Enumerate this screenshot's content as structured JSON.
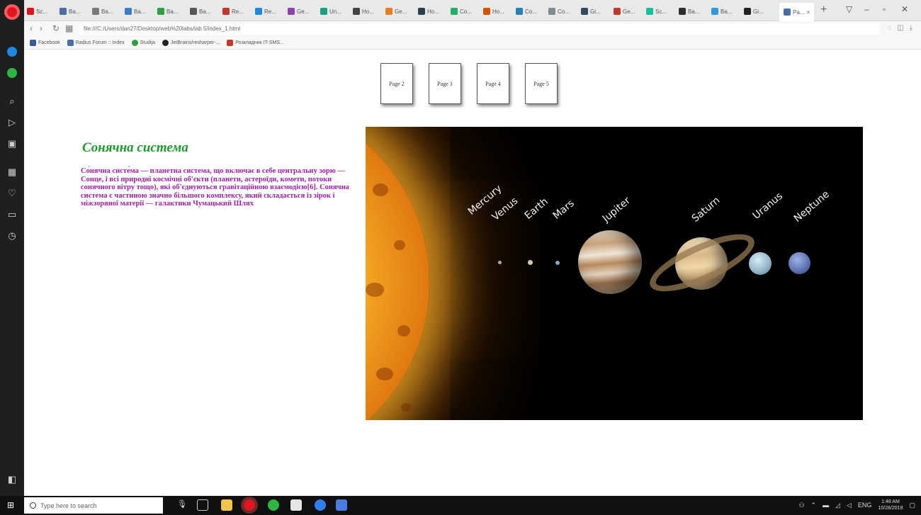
{
  "browser": {
    "tabs": [
      {
        "label": "Sc..."
      },
      {
        "label": "Ba..."
      },
      {
        "label": "Ba..."
      },
      {
        "label": "Ba..."
      },
      {
        "label": "Ba..."
      },
      {
        "label": "Ba..."
      },
      {
        "label": "Re..."
      },
      {
        "label": "Re..."
      },
      {
        "label": "Ge..."
      },
      {
        "label": "Un..."
      },
      {
        "label": "Ho..."
      },
      {
        "label": "Ge..."
      },
      {
        "label": "Ho..."
      },
      {
        "label": "Co..."
      },
      {
        "label": "Ho..."
      },
      {
        "label": "Co..."
      },
      {
        "label": "Co..."
      },
      {
        "label": "Gi..."
      },
      {
        "label": "Ge..."
      },
      {
        "label": "Sc..."
      },
      {
        "label": "Ba..."
      },
      {
        "label": "Ba..."
      },
      {
        "label": "Gi..."
      }
    ],
    "active_tab": {
      "label": "Pa..."
    },
    "address": "file:///C:/Users/dan27/Desktop/web%20labs/lab 5/index_1.html",
    "bookmarks": [
      {
        "label": "Facebook"
      },
      {
        "label": "Radius Forum :: Index"
      },
      {
        "label": "Studija"
      },
      {
        "label": "JetBrains/resharper-..."
      },
      {
        "label": "Розкладник IT-SMS..."
      }
    ]
  },
  "page": {
    "nav_pages": [
      "Page 2",
      "Page 3",
      "Page 4",
      "Page 5"
    ],
    "title": "Сонячна система",
    "text": "Со́нячна систе́ма — планетна система, що включає в себе центральну зорю — Сонце, і всі природні космічні об'єкти (планети, астероїди, комети, потоки сонячного вітру тощо), які об'єднуються гравітаційною взаємодією[6]. Сонячна система є частиною значно більшого комплексу, який складається із зірок і міжзоряної матерії — галактики Чумацький Шлях",
    "planets": [
      "Mercury",
      "Venus",
      "Earth",
      "Mars",
      "Jupiter",
      "Saturn",
      "Uranus",
      "Neptune"
    ]
  },
  "taskbar": {
    "search_placeholder": "Type here to search",
    "language": "ENG",
    "time": "1:48 AM",
    "date": "10/28/2018"
  },
  "colors": {
    "title": "#1e9a2d",
    "text": "#a020a8",
    "sidebar": "#1f1f1f",
    "taskbar": "#101010"
  }
}
